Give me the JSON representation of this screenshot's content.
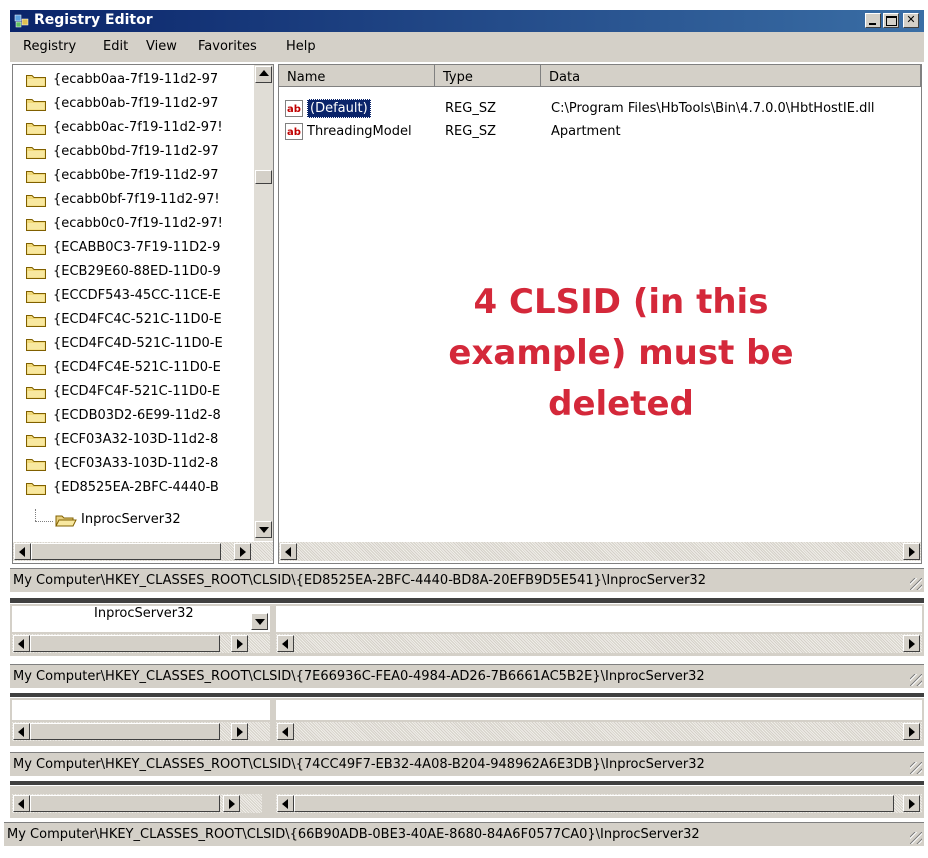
{
  "window": {
    "title": "Registry Editor"
  },
  "menu": [
    "Registry",
    "Edit",
    "View",
    "Favorites",
    "Help"
  ],
  "tree": {
    "items": [
      "{ecabb0aa-7f19-11d2-97",
      "{ecabb0ab-7f19-11d2-97",
      "{ecabb0ac-7f19-11d2-97!",
      "{ecabb0bd-7f19-11d2-97",
      "{ecabb0be-7f19-11d2-97",
      "{ecabb0bf-7f19-11d2-97!",
      "{ecabb0c0-7f19-11d2-97!",
      "{ECABB0C3-7F19-11D2-9",
      "{ECB29E60-88ED-11D0-9",
      "{ECCDF543-45CC-11CE-E",
      "{ECD4FC4C-521C-11D0-E",
      "{ECD4FC4D-521C-11D0-E",
      "{ECD4FC4E-521C-11D0-E",
      "{ECD4FC4F-521C-11D0-E",
      "{ECDB03D2-6E99-11d2-8",
      "{ECF03A32-103D-11d2-8",
      "{ECF03A33-103D-11d2-8",
      "{ED8525EA-2BFC-4440-B"
    ],
    "child": "InprocServer32"
  },
  "list": {
    "columns": [
      "Name",
      "Type",
      "Data"
    ],
    "rows": [
      {
        "name": "(Default)",
        "type": "REG_SZ",
        "data": "C:\\Program Files\\HbTools\\Bin\\4.7.0.0\\HbtHostIE.dll",
        "icon": "reg-sz-icon"
      },
      {
        "name": "ThreadingModel",
        "type": "REG_SZ",
        "data": "Apartment",
        "icon": "reg-sz-icon"
      }
    ]
  },
  "annotation": {
    "line1": "4 CLSID (in this",
    "line2": "example) must be",
    "line3": "deleted"
  },
  "status_bars": [
    "My Computer\\HKEY_CLASSES_ROOT\\CLSID\\{ED8525EA-2BFC-4440-BD8A-20EFB9D5E541}\\InprocServer32",
    "My Computer\\HKEY_CLASSES_ROOT\\CLSID\\{7E66936C-FEA0-4984-AD26-7B6661AC5B2E}\\InprocServer32",
    "My Computer\\HKEY_CLASSES_ROOT\\CLSID\\{74CC49F7-EB32-4A08-B204-948962A6E3DB}\\InprocServer32",
    "My Computer\\HKEY_CLASSES_ROOT\\CLSID\\{66B90ADB-0BE3-40AE-8680-84A6F0577CA0}\\InprocServer32"
  ],
  "fragment_label": "InprocServer32",
  "colors": {
    "titlebar": "#0a246a",
    "annotation": "#d4283a",
    "selection": "#0a246a",
    "chrome": "#d4d0c8"
  }
}
